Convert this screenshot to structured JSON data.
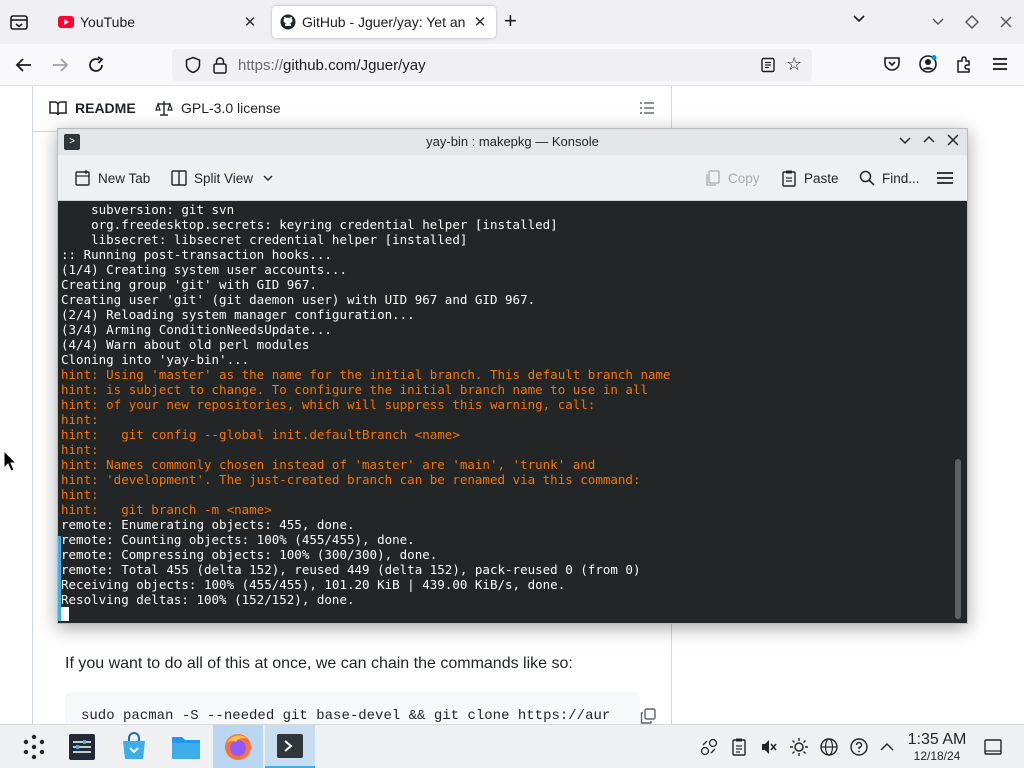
{
  "browser": {
    "tabs": [
      {
        "title": "YouTube",
        "active": false
      },
      {
        "title": "GitHub - Jguer/yay: Yet an",
        "active": true
      }
    ],
    "url_protocol": "https://",
    "url_rest": "github.com/Jguer/yay"
  },
  "page": {
    "readme_tab": "README",
    "license_tab": "GPL-3.0 license",
    "paragraph": "If you want to do all of this at once, we can chain the commands like so:",
    "code": "sudo pacman -S --needed git base-devel && git clone https://aur"
  },
  "konsole": {
    "title": "yay-bin : makepkg — Konsole",
    "toolbar": {
      "new_tab": "New Tab",
      "split_view": "Split View",
      "copy": "Copy",
      "paste": "Paste",
      "find": "Find..."
    },
    "lines": [
      {
        "text": "    subversion: git svn",
        "kind": "normal"
      },
      {
        "text": "    org.freedesktop.secrets: keyring credential helper [installed]",
        "kind": "normal"
      },
      {
        "text": "    libsecret: libsecret credential helper [installed]",
        "kind": "normal"
      },
      {
        "text": ":: Running post-transaction hooks...",
        "kind": "normal"
      },
      {
        "text": "(1/4) Creating system user accounts...",
        "kind": "normal"
      },
      {
        "text": "Creating group 'git' with GID 967.",
        "kind": "normal"
      },
      {
        "text": "Creating user 'git' (git daemon user) with UID 967 and GID 967.",
        "kind": "normal"
      },
      {
        "text": "(2/4) Reloading system manager configuration...",
        "kind": "normal"
      },
      {
        "text": "(3/4) Arming ConditionNeedsUpdate...",
        "kind": "normal"
      },
      {
        "text": "(4/4) Warn about old perl modules",
        "kind": "normal"
      },
      {
        "text": "Cloning into 'yay-bin'...",
        "kind": "normal"
      },
      {
        "text": "hint: Using 'master' as the name for the initial branch. This default branch name",
        "kind": "hint"
      },
      {
        "text": "hint: is subject to change. To configure the initial branch name to use in all",
        "kind": "hint"
      },
      {
        "text": "hint: of your new repositories, which will suppress this warning, call:",
        "kind": "hint"
      },
      {
        "text": "hint:",
        "kind": "hint"
      },
      {
        "text": "hint:   git config --global init.defaultBranch <name>",
        "kind": "hint"
      },
      {
        "text": "hint:",
        "kind": "hint"
      },
      {
        "text": "hint: Names commonly chosen instead of 'master' are 'main', 'trunk' and",
        "kind": "hint"
      },
      {
        "text": "hint: 'development'. The just-created branch can be renamed via this command:",
        "kind": "hint"
      },
      {
        "text": "hint:",
        "kind": "hint"
      },
      {
        "text": "hint:   git branch -m <name>",
        "kind": "hint"
      },
      {
        "text": "remote: Enumerating objects: 455, done.",
        "kind": "normal"
      },
      {
        "text": "remote: Counting objects: 100% (455/455), done.",
        "kind": "normal"
      },
      {
        "text": "remote: Compressing objects: 100% (300/300), done.",
        "kind": "normal"
      },
      {
        "text": "remote: Total 455 (delta 152), reused 449 (delta 152), pack-reused 0 (from 0)",
        "kind": "normal"
      },
      {
        "text": "Receiving objects: 100% (455/455), 101.20 KiB | 439.00 KiB/s, done.",
        "kind": "normal"
      },
      {
        "text": "Resolving deltas: 100% (152/152), done.",
        "kind": "normal"
      }
    ]
  },
  "taskbar": {
    "time": "1:35 AM",
    "date": "12/18/24"
  }
}
